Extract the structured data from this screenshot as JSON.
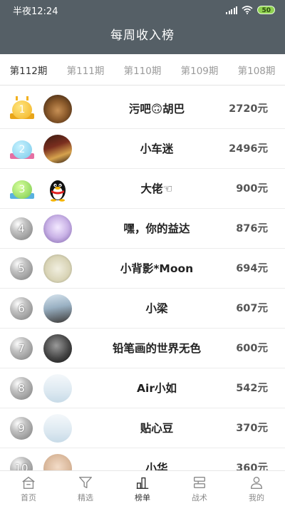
{
  "status": {
    "time": "半夜12:24",
    "battery": "50"
  },
  "header": {
    "title": "每周收入榜"
  },
  "tabs": [
    {
      "label": "第112期"
    },
    {
      "label": "第111期"
    },
    {
      "label": "第110期"
    },
    {
      "label": "第109期"
    },
    {
      "label": "第108期"
    }
  ],
  "ranking": [
    {
      "rank": "1",
      "name": "污吧🙃胡巴",
      "amount": "2720元"
    },
    {
      "rank": "2",
      "name": "小车迷",
      "amount": "2496元"
    },
    {
      "rank": "3",
      "name": "大佬☜",
      "amount": "900元"
    },
    {
      "rank": "4",
      "name": "嘿，你的益达",
      "amount": "876元"
    },
    {
      "rank": "5",
      "name": "小背影*Moon",
      "amount": "694元"
    },
    {
      "rank": "6",
      "name": "小梁",
      "amount": "607元"
    },
    {
      "rank": "7",
      "name": "铅笔画的世界无色",
      "amount": "600元"
    },
    {
      "rank": "8",
      "name": "Air小如",
      "amount": "542元"
    },
    {
      "rank": "9",
      "name": "贴心豆",
      "amount": "370元"
    },
    {
      "rank": "10",
      "name": "小华",
      "amount": "360元"
    }
  ],
  "nav": [
    {
      "label": "首页",
      "icon": "home-icon"
    },
    {
      "label": "精选",
      "icon": "filter-icon"
    },
    {
      "label": "榜单",
      "icon": "chart-icon"
    },
    {
      "label": "战术",
      "icon": "layers-icon"
    },
    {
      "label": "我的",
      "icon": "user-icon"
    }
  ]
}
